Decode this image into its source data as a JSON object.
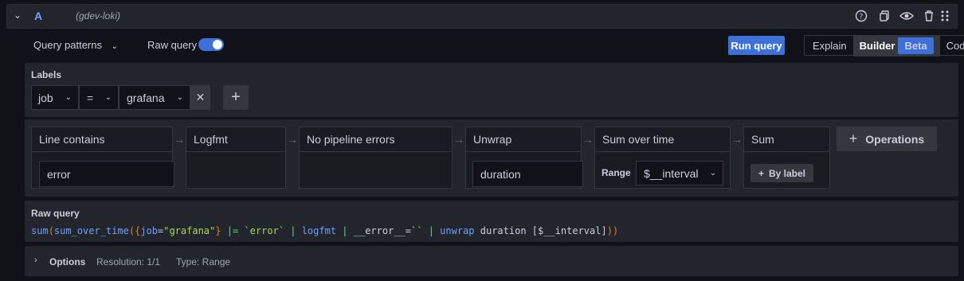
{
  "row": {
    "letter": "A",
    "datasource": "(gdev-loki)",
    "icons": [
      "help-icon",
      "copy-icon",
      "eye-icon",
      "trash-icon",
      "drag-handle-icon"
    ]
  },
  "toolbar": {
    "query_patterns": "Query patterns",
    "raw_query_label": "Raw query",
    "raw_query_on": true,
    "run_query": "Run query",
    "modes": {
      "explain": "Explain",
      "builder": "Builder",
      "beta": "Beta",
      "code": "Code"
    }
  },
  "labels": {
    "title": "Labels",
    "key": "job",
    "operator": "=",
    "value": "grafana"
  },
  "operations": [
    {
      "title": "Line contains",
      "input": "error"
    },
    {
      "title": "Logfmt"
    },
    {
      "title": "No pipeline errors"
    },
    {
      "title": "Unwrap",
      "input": "duration"
    },
    {
      "title": "Sum over time",
      "param_label": "Range",
      "param_value": "$__interval"
    },
    {
      "title": "Sum",
      "button": "By label"
    }
  ],
  "add_operations": "Operations",
  "raw": {
    "title": "Raw query"
  },
  "options": {
    "title": "Options",
    "resolution": "Resolution: 1/1",
    "type": "Type: Range"
  },
  "colors": {
    "accent": "#3d71d9",
    "panel": "#22252b",
    "background": "#111217"
  }
}
